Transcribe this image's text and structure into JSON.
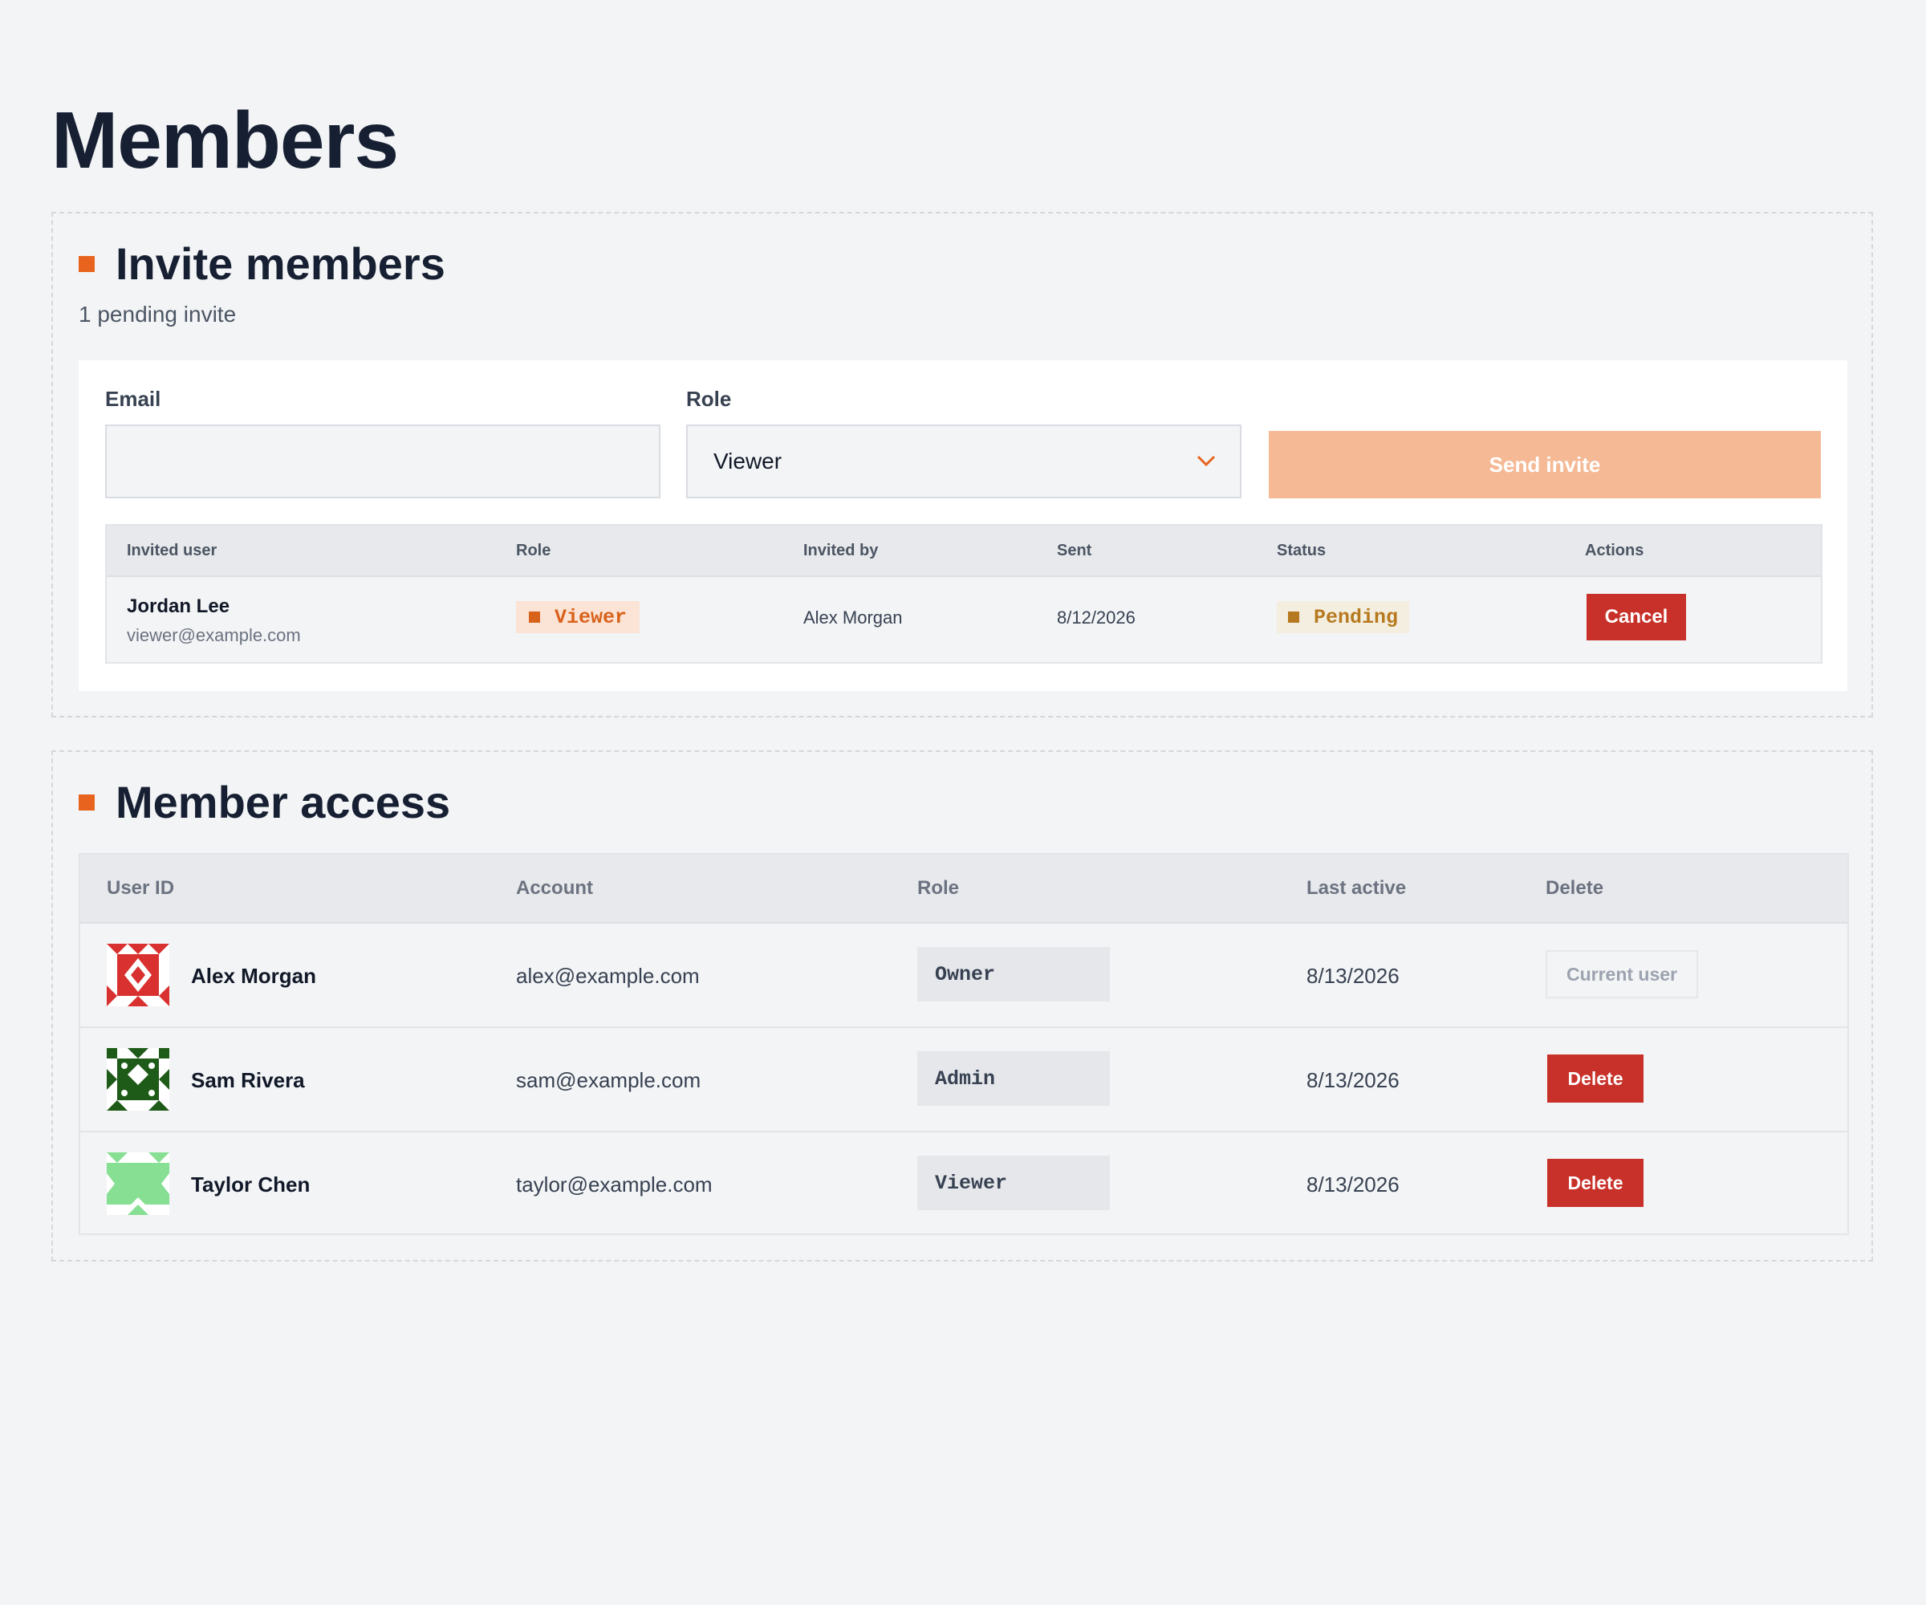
{
  "page": {
    "title": "Members"
  },
  "colors": {
    "accent": "#e8641e",
    "danger": "#c8312a",
    "send_disabled": "#f5b995"
  },
  "invite": {
    "title": "Invite members",
    "pending_text": "1 pending invite",
    "email_label": "Email",
    "email_value": "",
    "role_label": "Role",
    "role_value": "Viewer",
    "send_label": "Send invite",
    "columns": [
      "Invited user",
      "Role",
      "Invited by",
      "Sent",
      "Status",
      "Actions"
    ],
    "rows": [
      {
        "name": "Jordan Lee",
        "email": "viewer@example.com",
        "role": "Viewer",
        "invited_by": "Alex Morgan",
        "sent": "8/12/2026",
        "status": "Pending",
        "action": "Cancel"
      }
    ]
  },
  "access": {
    "title": "Member access",
    "columns": [
      "User ID",
      "Account",
      "Role",
      "Last active",
      "Delete"
    ],
    "rows": [
      {
        "name": "Alex Morgan",
        "email": "alex@example.com",
        "role": "Owner",
        "last_active": "8/13/2026",
        "action": "Current user",
        "avatar_icon": "red-geometric-avatar-icon",
        "avatar_color": "#d8312f"
      },
      {
        "name": "Sam Rivera",
        "email": "sam@example.com",
        "role": "Admin",
        "last_active": "8/13/2026",
        "action": "Delete",
        "avatar_icon": "green-geometric-avatar-icon",
        "avatar_color": "#1f5b18"
      },
      {
        "name": "Taylor Chen",
        "email": "taylor@example.com",
        "role": "Viewer",
        "last_active": "8/13/2026",
        "action": "Delete",
        "avatar_icon": "mint-geometric-avatar-icon",
        "avatar_color": "#86df93"
      }
    ]
  }
}
